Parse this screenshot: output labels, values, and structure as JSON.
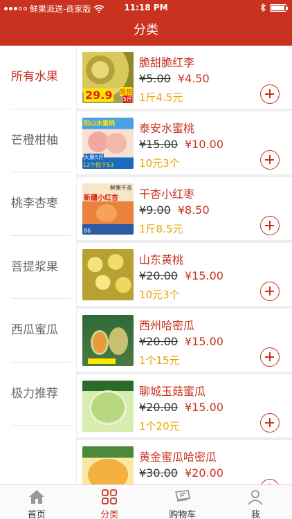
{
  "status": {
    "carrier": "鲜果派送-商家版",
    "time": "11:18 PM",
    "battery_level": 0.95
  },
  "nav": {
    "title": "分类"
  },
  "sidebar": {
    "items": [
      {
        "label": "所有水果"
      },
      {
        "label": "芒橙柑柚"
      },
      {
        "label": "桃李杏枣"
      },
      {
        "label": "菩提浆果"
      },
      {
        "label": "西瓜蜜瓜"
      },
      {
        "label": "极力推荐"
      }
    ]
  },
  "products": [
    {
      "name": "脆甜脆红李",
      "old_price": "¥5.00",
      "price": "¥4.50",
      "unit": "1斤4.5元",
      "thumb_bg": "#cdb04a",
      "thumb_text": "29.9",
      "thumb_text2": "现货",
      "thumb_text3": "5斤"
    },
    {
      "name": "泰安水蜜桃",
      "old_price": "¥15.00",
      "price": "¥10.00",
      "unit": "10元3个",
      "thumb_bg": "#f3c9b8",
      "thumb_text": "阳山水蜜桃",
      "thumb_text2": "大果5斤",
      "thumb_text3": "12个拍下53"
    },
    {
      "name": "干杏小红枣",
      "old_price": "¥9.00",
      "price": "¥8.50",
      "unit": "1斤8.5元",
      "thumb_bg": "#e9823a",
      "thumb_text": "新疆小红杏",
      "thumb_text2": "鲜果干杏",
      "thumb_text3": "86"
    },
    {
      "name": "山东黄桃",
      "old_price": "¥20.00",
      "price": "¥15.00",
      "unit": "10元3个",
      "thumb_bg": "#c9b63a",
      "thumb_text": "",
      "thumb_text2": "",
      "thumb_text3": ""
    },
    {
      "name": "西州哈密瓜",
      "old_price": "¥20.00",
      "price": "¥15.00",
      "unit": "1个15元",
      "thumb_bg": "#8a9a5a",
      "thumb_text": "",
      "thumb_text2": "",
      "thumb_text3": ""
    },
    {
      "name": "聊城玉菇蜜瓜",
      "old_price": "¥20.00",
      "price": "¥15.00",
      "unit": "1个20元",
      "thumb_bg": "#9bc06a",
      "thumb_text": "",
      "thumb_text2": "",
      "thumb_text3": ""
    },
    {
      "name": "黄金蜜瓜哈密瓜",
      "old_price": "¥30.00",
      "price": "¥20.00",
      "unit": "",
      "thumb_bg": "#e8b840",
      "thumb_text": "",
      "thumb_text2": "",
      "thumb_text3": ""
    }
  ],
  "tabbar": {
    "items": [
      {
        "label": "首页",
        "icon": "home-icon"
      },
      {
        "label": "分类",
        "icon": "category-grid-icon"
      },
      {
        "label": "购物车",
        "icon": "cart-icon"
      },
      {
        "label": "我",
        "icon": "user-icon"
      }
    ]
  },
  "colors": {
    "brand": "#c8321f",
    "unit_text": "#e8a500"
  }
}
